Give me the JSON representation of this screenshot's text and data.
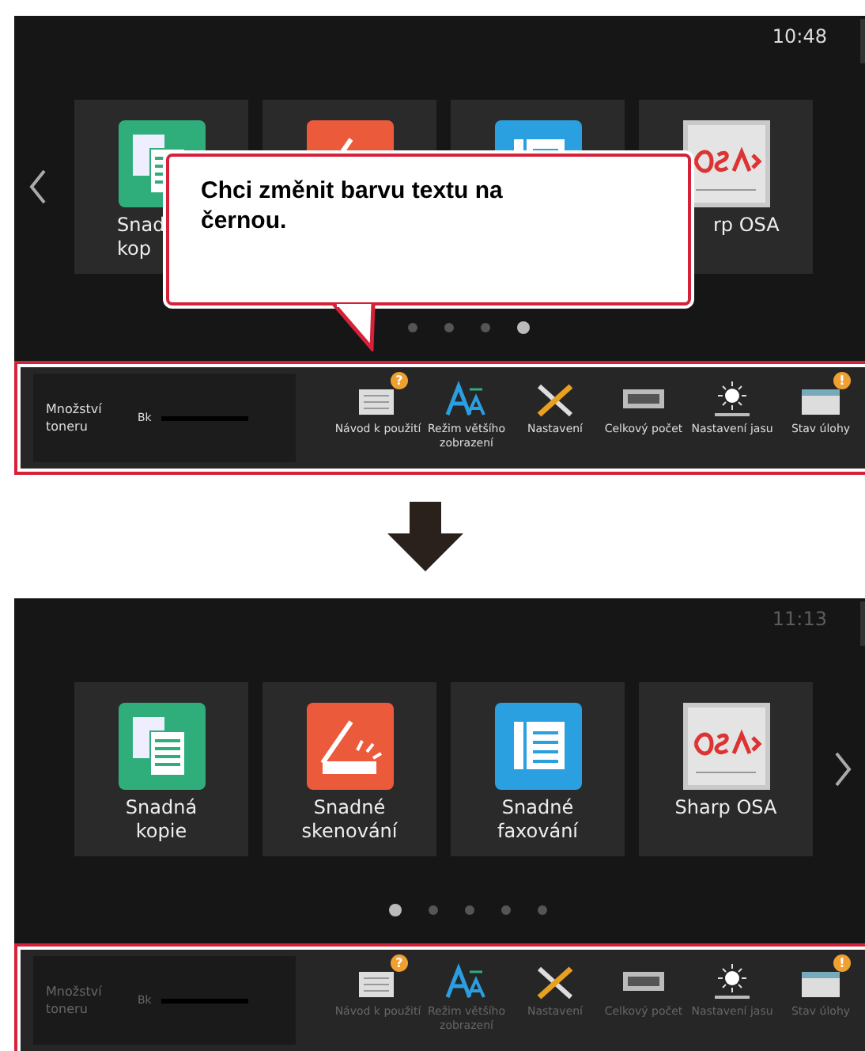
{
  "screens": [
    {
      "clock": "10:48",
      "dark_text": false,
      "arrow_left": true,
      "arrow_right": false,
      "tiles": [
        {
          "kind": "copy",
          "lines": [
            "Snad",
            "kop"
          ]
        },
        {
          "kind": "scan"
        },
        {
          "kind": "fax"
        },
        {
          "kind": "osa",
          "lines": [
            "rp OSA"
          ]
        }
      ],
      "dots": [
        {
          "selected": false
        },
        {
          "selected": false
        },
        {
          "selected": false
        },
        {
          "selected": true
        }
      ],
      "callout": {
        "text": "Chci změnit barvu textu na černou."
      },
      "bar": {
        "highlighted": true,
        "toner_label": "Množství toneru",
        "toner_color": "Bk",
        "level": 1,
        "items": [
          {
            "kind": "manual",
            "label": "Návod k použití",
            "badge": "?"
          },
          {
            "kind": "textsize",
            "label": "Režim většího zobrazení"
          },
          {
            "kind": "settings",
            "label": "Nastavení"
          },
          {
            "kind": "counter",
            "label": "Celkový počet"
          },
          {
            "kind": "brightness",
            "label": "Nastavení jasu"
          },
          {
            "kind": "jobs",
            "label": "Stav úlohy",
            "badge": "!"
          }
        ]
      }
    },
    {
      "clock": "11:13",
      "dark_text": true,
      "arrow_left": false,
      "arrow_right": true,
      "tiles": [
        {
          "kind": "copy",
          "lines": [
            "Snadná",
            "kopie"
          ]
        },
        {
          "kind": "scan",
          "lines": [
            "Snadné",
            "skenování"
          ]
        },
        {
          "kind": "fax",
          "lines": [
            "Snadné",
            "faxování"
          ]
        },
        {
          "kind": "osa",
          "lines": [
            "Sharp OSA"
          ]
        }
      ],
      "dots": [
        {
          "selected": true
        },
        {
          "selected": false
        },
        {
          "selected": false
        },
        {
          "selected": false
        },
        {
          "selected": false
        }
      ],
      "bar": {
        "highlighted": true,
        "toner_label": "Množství toneru",
        "toner_color": "Bk",
        "level": 1,
        "items": [
          {
            "kind": "manual",
            "label": "Návod k použití",
            "badge": "?"
          },
          {
            "kind": "textsize",
            "label": "Režim většího zobrazení"
          },
          {
            "kind": "settings",
            "label": "Nastavení"
          },
          {
            "kind": "counter",
            "label": "Celkový počet"
          },
          {
            "kind": "brightness",
            "label": "Nastavení jasu"
          },
          {
            "kind": "jobs",
            "label": "Stav úlohy",
            "badge": "!"
          }
        ]
      }
    }
  ]
}
